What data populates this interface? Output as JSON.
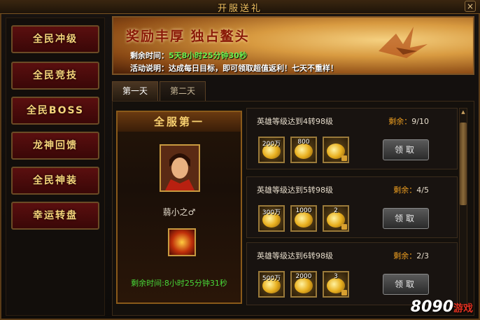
{
  "window": {
    "title": "开服送礼",
    "close_glyph": "×"
  },
  "sidebar": {
    "items": [
      {
        "label": "全民冲级"
      },
      {
        "label": "全民竞技"
      },
      {
        "label": "全民BOSS"
      },
      {
        "label": "龙神回馈"
      },
      {
        "label": "全民神装"
      },
      {
        "label": "幸运转盘"
      }
    ]
  },
  "banner": {
    "title": "奖励丰厚 独占鳌头",
    "time_label": "剩余时间：",
    "time_value": "5天8小时25分钟30秒",
    "desc_label": "活动说明：",
    "desc_value": "达成每日目标，即可领取超值返利！七天不重样！"
  },
  "tabs": [
    {
      "label": "第一天",
      "active": true
    },
    {
      "label": "第二天",
      "active": false
    }
  ],
  "rank": {
    "heading": "全服第一",
    "player_name": "蒻小之♂",
    "remaining": "剩余时间:8小时25分钟31秒",
    "icons": {
      "portrait": "hero-portrait-icon",
      "reward": "fire-wings-icon"
    }
  },
  "tasks": [
    {
      "title": "英雄等级达到4转98级",
      "remain_label": "剩余：",
      "remain_value": "9/10",
      "rewards": [
        {
          "qty": "200万",
          "icon": "gold-coin-icon"
        },
        {
          "qty": "800",
          "icon": "gold-ingot-icon"
        },
        {
          "qty": "",
          "icon": "gold-coin-icon"
        }
      ],
      "button": "领取"
    },
    {
      "title": "英雄等级达到5转98级",
      "remain_label": "剩余：",
      "remain_value": "4/5",
      "rewards": [
        {
          "qty": "300万",
          "icon": "gold-coin-icon"
        },
        {
          "qty": "1000",
          "icon": "gold-ingot-icon"
        },
        {
          "qty": "2",
          "icon": "gold-coin-icon"
        }
      ],
      "button": "领取"
    },
    {
      "title": "英雄等级达到6转98级",
      "remain_label": "剩余：",
      "remain_value": "2/3",
      "rewards": [
        {
          "qty": "500万",
          "icon": "gold-coin-icon"
        },
        {
          "qty": "2000",
          "icon": "gold-ingot-icon"
        },
        {
          "qty": "3",
          "icon": "gold-coin-icon"
        }
      ],
      "button": "领取"
    }
  ],
  "watermark": {
    "logo": "8090",
    "text": "游戏"
  },
  "colors": {
    "accent": "#f6d37a",
    "remain_label": "#f0a020",
    "timer_green": "#48d838"
  }
}
